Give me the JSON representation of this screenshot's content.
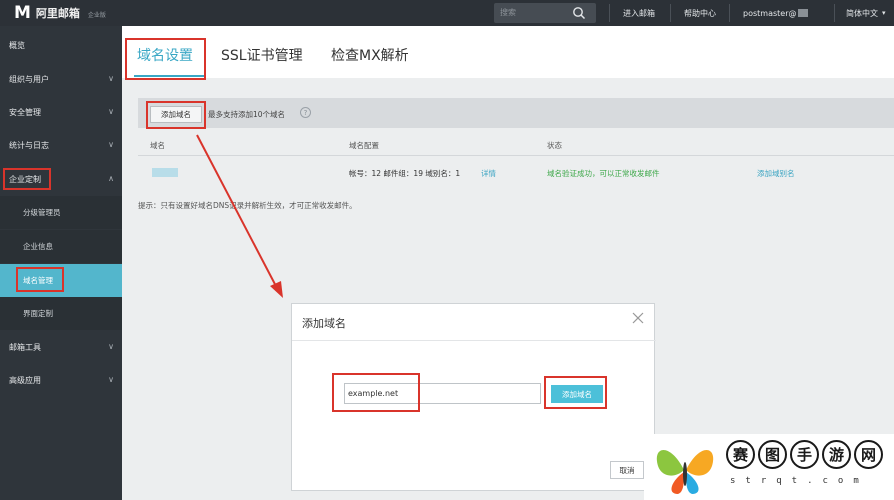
{
  "header": {
    "logo_mark": "M",
    "logo_text": "阿里邮箱",
    "logo_sub": "企业版",
    "search_placeholder": "搜索",
    "nav": [
      "进入邮箱",
      "帮助中心"
    ],
    "user": "postmaster@",
    "lang": "简体中文"
  },
  "sidebar": {
    "items": [
      {
        "label": "概览"
      },
      {
        "label": "组织与用户"
      },
      {
        "label": "安全管理"
      },
      {
        "label": "统计与日志"
      },
      {
        "label": "企业定制"
      }
    ],
    "sub_items": [
      {
        "label": "分级管理员"
      },
      {
        "label": "企业信息"
      },
      {
        "label": "域名管理"
      },
      {
        "label": "界面定制"
      }
    ],
    "bottom_items": [
      {
        "label": "邮箱工具"
      },
      {
        "label": "高级应用"
      }
    ]
  },
  "tabs": [
    "域名设置",
    "SSL证书管理",
    "检查MX解析"
  ],
  "toolbar": {
    "add_label": "添加域名",
    "tip": "最多支持添加10个域名",
    "help": "?"
  },
  "table": {
    "columns": [
      "域名",
      "域名配置",
      "状态"
    ],
    "rows": [
      {
        "config": "帐号：12  邮件组：19  域别名：1",
        "detail": "详情",
        "status": "域名验证成功，可以正常收发邮件",
        "action": "添加域别名"
      }
    ]
  },
  "notice": "提示：只有设置好域名DNS记录并解析生效，才可正常收发邮件。",
  "modal": {
    "title": "添加域名",
    "input_value": "example.net",
    "confirm_label": "添加域名",
    "cancel_label": "取消"
  },
  "watermark": {
    "chars": [
      "赛",
      "图",
      "手",
      "游",
      "网"
    ],
    "sub": "strqt.com"
  },
  "colors": {
    "accent": "#39a7c5",
    "sidebar_bg": "#2f353b",
    "topbar_bg": "#2c3137",
    "highlight_red": "#d9342b",
    "success_green": "#3ea84a"
  }
}
